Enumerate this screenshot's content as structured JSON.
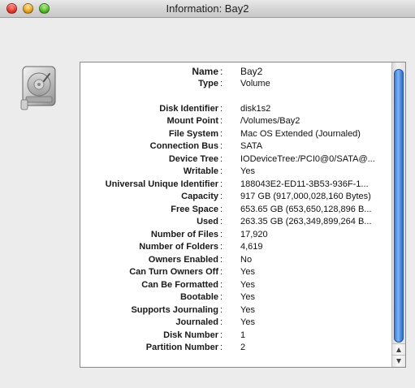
{
  "window": {
    "title": "Information: Bay2"
  },
  "icons": {
    "disk": "hard-disk-icon"
  },
  "info": {
    "rows": [
      {
        "label": "Name",
        "value": "Bay2",
        "type": "title"
      },
      {
        "label": "Type",
        "value": "Volume",
        "type": "normal"
      },
      {
        "label": "",
        "value": "",
        "type": "spacer"
      },
      {
        "label": "Disk Identifier",
        "value": "disk1s2",
        "type": "normal"
      },
      {
        "label": "Mount Point",
        "value": "/Volumes/Bay2",
        "type": "normal"
      },
      {
        "label": "File System",
        "value": "Mac OS Extended (Journaled)",
        "type": "normal"
      },
      {
        "label": "Connection Bus",
        "value": "SATA",
        "type": "normal"
      },
      {
        "label": "Device Tree",
        "value": "IODeviceTree:/PCI0@0/SATA@...",
        "type": "normal"
      },
      {
        "label": "Writable",
        "value": "Yes",
        "type": "normal"
      },
      {
        "label": "Universal Unique Identifier",
        "value": "188043E2-ED11-3B53-936F-1...",
        "type": "normal"
      },
      {
        "label": "Capacity",
        "value": "917 GB (917,000,028,160 Bytes)",
        "type": "normal"
      },
      {
        "label": "Free Space",
        "value": "653.65 GB (653,650,128,896 B...",
        "type": "normal"
      },
      {
        "label": "Used",
        "value": "263.35 GB (263,349,899,264 B...",
        "type": "normal"
      },
      {
        "label": "Number of Files",
        "value": "17,920",
        "type": "normal"
      },
      {
        "label": "Number of Folders",
        "value": "4,619",
        "type": "normal"
      },
      {
        "label": "Owners Enabled",
        "value": "No",
        "type": "normal"
      },
      {
        "label": "Can Turn Owners Off",
        "value": "Yes",
        "type": "normal"
      },
      {
        "label": "Can Be Formatted",
        "value": "Yes",
        "type": "normal"
      },
      {
        "label": "Bootable",
        "value": "Yes",
        "type": "normal"
      },
      {
        "label": "Supports Journaling",
        "value": "Yes",
        "type": "normal"
      },
      {
        "label": "Journaled",
        "value": "Yes",
        "type": "normal"
      },
      {
        "label": "Disk Number",
        "value": "1",
        "type": "normal"
      },
      {
        "label": "Partition Number",
        "value": "2",
        "type": "normal"
      }
    ],
    "separator": ":"
  }
}
